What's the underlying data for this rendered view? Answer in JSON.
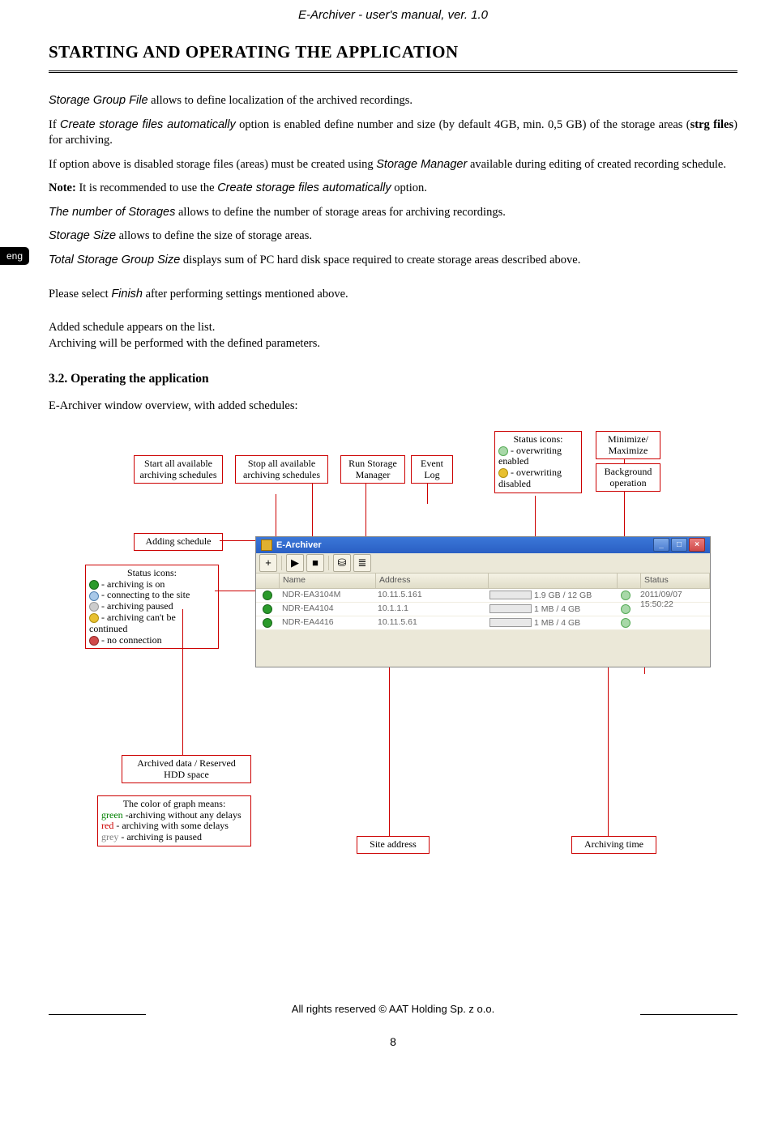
{
  "header": "E-Archiver - user's manual, ver. 1.0",
  "section_title": "STARTING AND OPERATING THE APPLICATION",
  "eng_tab": "eng",
  "para1_a": "Storage Group File",
  "para1_b": " allows to define localization of the archived recordings.",
  "para2_a": "If ",
  "para2_b": "Create storage files automatically",
  "para2_c": " option is enabled define number and size (by default 4GB, min. 0,5 GB) of the storage areas (",
  "para2_d": "strg files",
  "para2_e": ") for archiving.",
  "para3_a": "If option above is disabled storage files (areas) must be created using ",
  "para3_b": "Storage Manager",
  "para3_c": " available during editing of created recording schedule.",
  "para4_a": "Note:",
  "para4_b": " It is recommended to use the ",
  "para4_c": "Create storage files automatically",
  "para4_d": " option.",
  "para5_a": "The number of Storages",
  "para5_b": " allows to define the number of storage areas for archiving recordings.",
  "para6_a": "Storage Size",
  "para6_b": " allows to define the size of storage areas.",
  "para7_a": "Total Storage Group Size",
  "para7_b": " displays sum of PC hard disk space required to create storage areas described above.",
  "para8_a": "Please select ",
  "para8_b": "Finish",
  "para8_c": " after performing settings mentioned above.",
  "para9": "Added schedule appears on the list.",
  "para10": "Archiving will be performed with the defined parameters.",
  "subheading": "3.2. Operating the application",
  "para11": "E-Archiver window overview, with added schedules:",
  "callouts": {
    "start_all": "Start all available archiving schedules",
    "stop_all": "Stop all available archiving schedules",
    "run_storage": "Run Storage Manager",
    "event_log": "Event Log",
    "status_overwrite_header": "Status icons:",
    "status_overwrite_on": " - overwriting enabled",
    "status_overwrite_off": " - overwriting disabled",
    "min_max": "Minimize/ Maximize",
    "bg_op": "Background operation",
    "bg_op2": "Background operation",
    "adding_sched": "Adding schedule",
    "status_left_header": "Status icons:",
    "status_left_on": " - archiving is on",
    "status_left_conn": " - connecting to the site",
    "status_left_pause": " - archiving paused",
    "status_left_cant": " - archiving can't be continued",
    "status_left_noconn": " - no connection",
    "arch_data": "Archived data / Reserved HDD space",
    "color_graph_header": "The color of graph means:",
    "color_green_label": "green",
    "color_green_text": " -archiving without any delays",
    "color_red_label": "red ",
    "color_red_text": "-   archiving with some delays",
    "color_grey_label": "grey ",
    "color_grey_text": "-  archiving is paused",
    "site_addr": "Site address",
    "arch_time": "Archiving time"
  },
  "app": {
    "title": "E-Archiver",
    "cols": {
      "name": "Name",
      "addr": "Address",
      "status": "Status"
    },
    "rows": [
      {
        "name": "NDR-EA3104M",
        "addr": "10.11.5.161",
        "space": "1.9 GB / 12 GB",
        "time": "2011/09/07 15:50:22",
        "fill": 16
      },
      {
        "name": "NDR-EA4104",
        "addr": "10.1.1.1",
        "space": "1 MB / 4 GB",
        "time": "",
        "fill": 2
      },
      {
        "name": "NDR-EA4416",
        "addr": "10.11.5.61",
        "space": "1 MB / 4 GB",
        "time": "",
        "fill": 2
      }
    ]
  },
  "footer_text": "All rights reserved © AAT Holding Sp. z o.o.",
  "page_number": "8"
}
